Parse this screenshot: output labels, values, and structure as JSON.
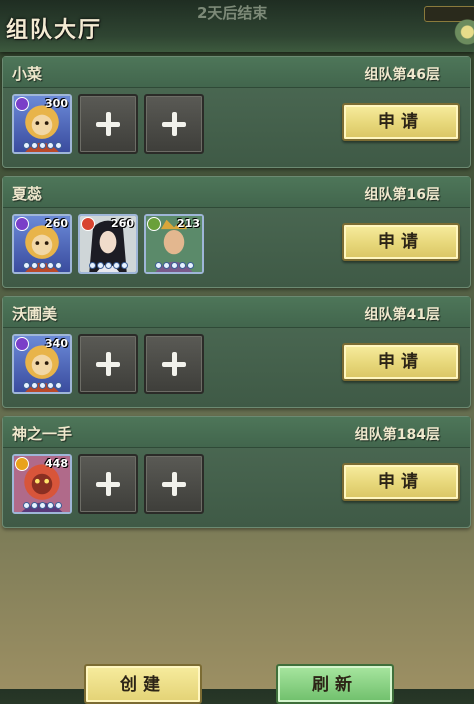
{
  "header": {
    "title": "组队大厅",
    "countdown": "2天后结束"
  },
  "teams": [
    {
      "name": "小菜",
      "floor": "组队第46层",
      "apply_label": "申请",
      "members": [
        {
          "level": "300",
          "portrait": "monkey-king",
          "badge_color": "#7a3fc8"
        },
        null,
        null
      ]
    },
    {
      "name": "夏蕊",
      "floor": "组队第16层",
      "apply_label": "申请",
      "members": [
        {
          "level": "260",
          "portrait": "monkey-king",
          "badge_color": "#7a3fc8"
        },
        {
          "level": "260",
          "portrait": "dark-haired-woman",
          "badge_color": "#d8442f"
        },
        {
          "level": "213",
          "portrait": "crowned-warrior",
          "badge_color": "#6aa03a"
        }
      ]
    },
    {
      "name": "沃圃美",
      "floor": "组队第41层",
      "apply_label": "申请",
      "members": [
        {
          "level": "340",
          "portrait": "monkey-king",
          "badge_color": "#7a3fc8"
        },
        null,
        null
      ]
    },
    {
      "name": "神之一手",
      "floor": "组队第184层",
      "apply_label": "申请",
      "members": [
        {
          "level": "448",
          "portrait": "demon-beast",
          "badge_color": "#e9a21b"
        },
        null,
        null
      ]
    }
  ],
  "footer": {
    "create_label": "创建",
    "refresh_label": "刷新"
  },
  "colors": {
    "apply_button": "#e7d77a",
    "refresh_button": "#6fbf6b",
    "card_header": "#4e7659"
  }
}
